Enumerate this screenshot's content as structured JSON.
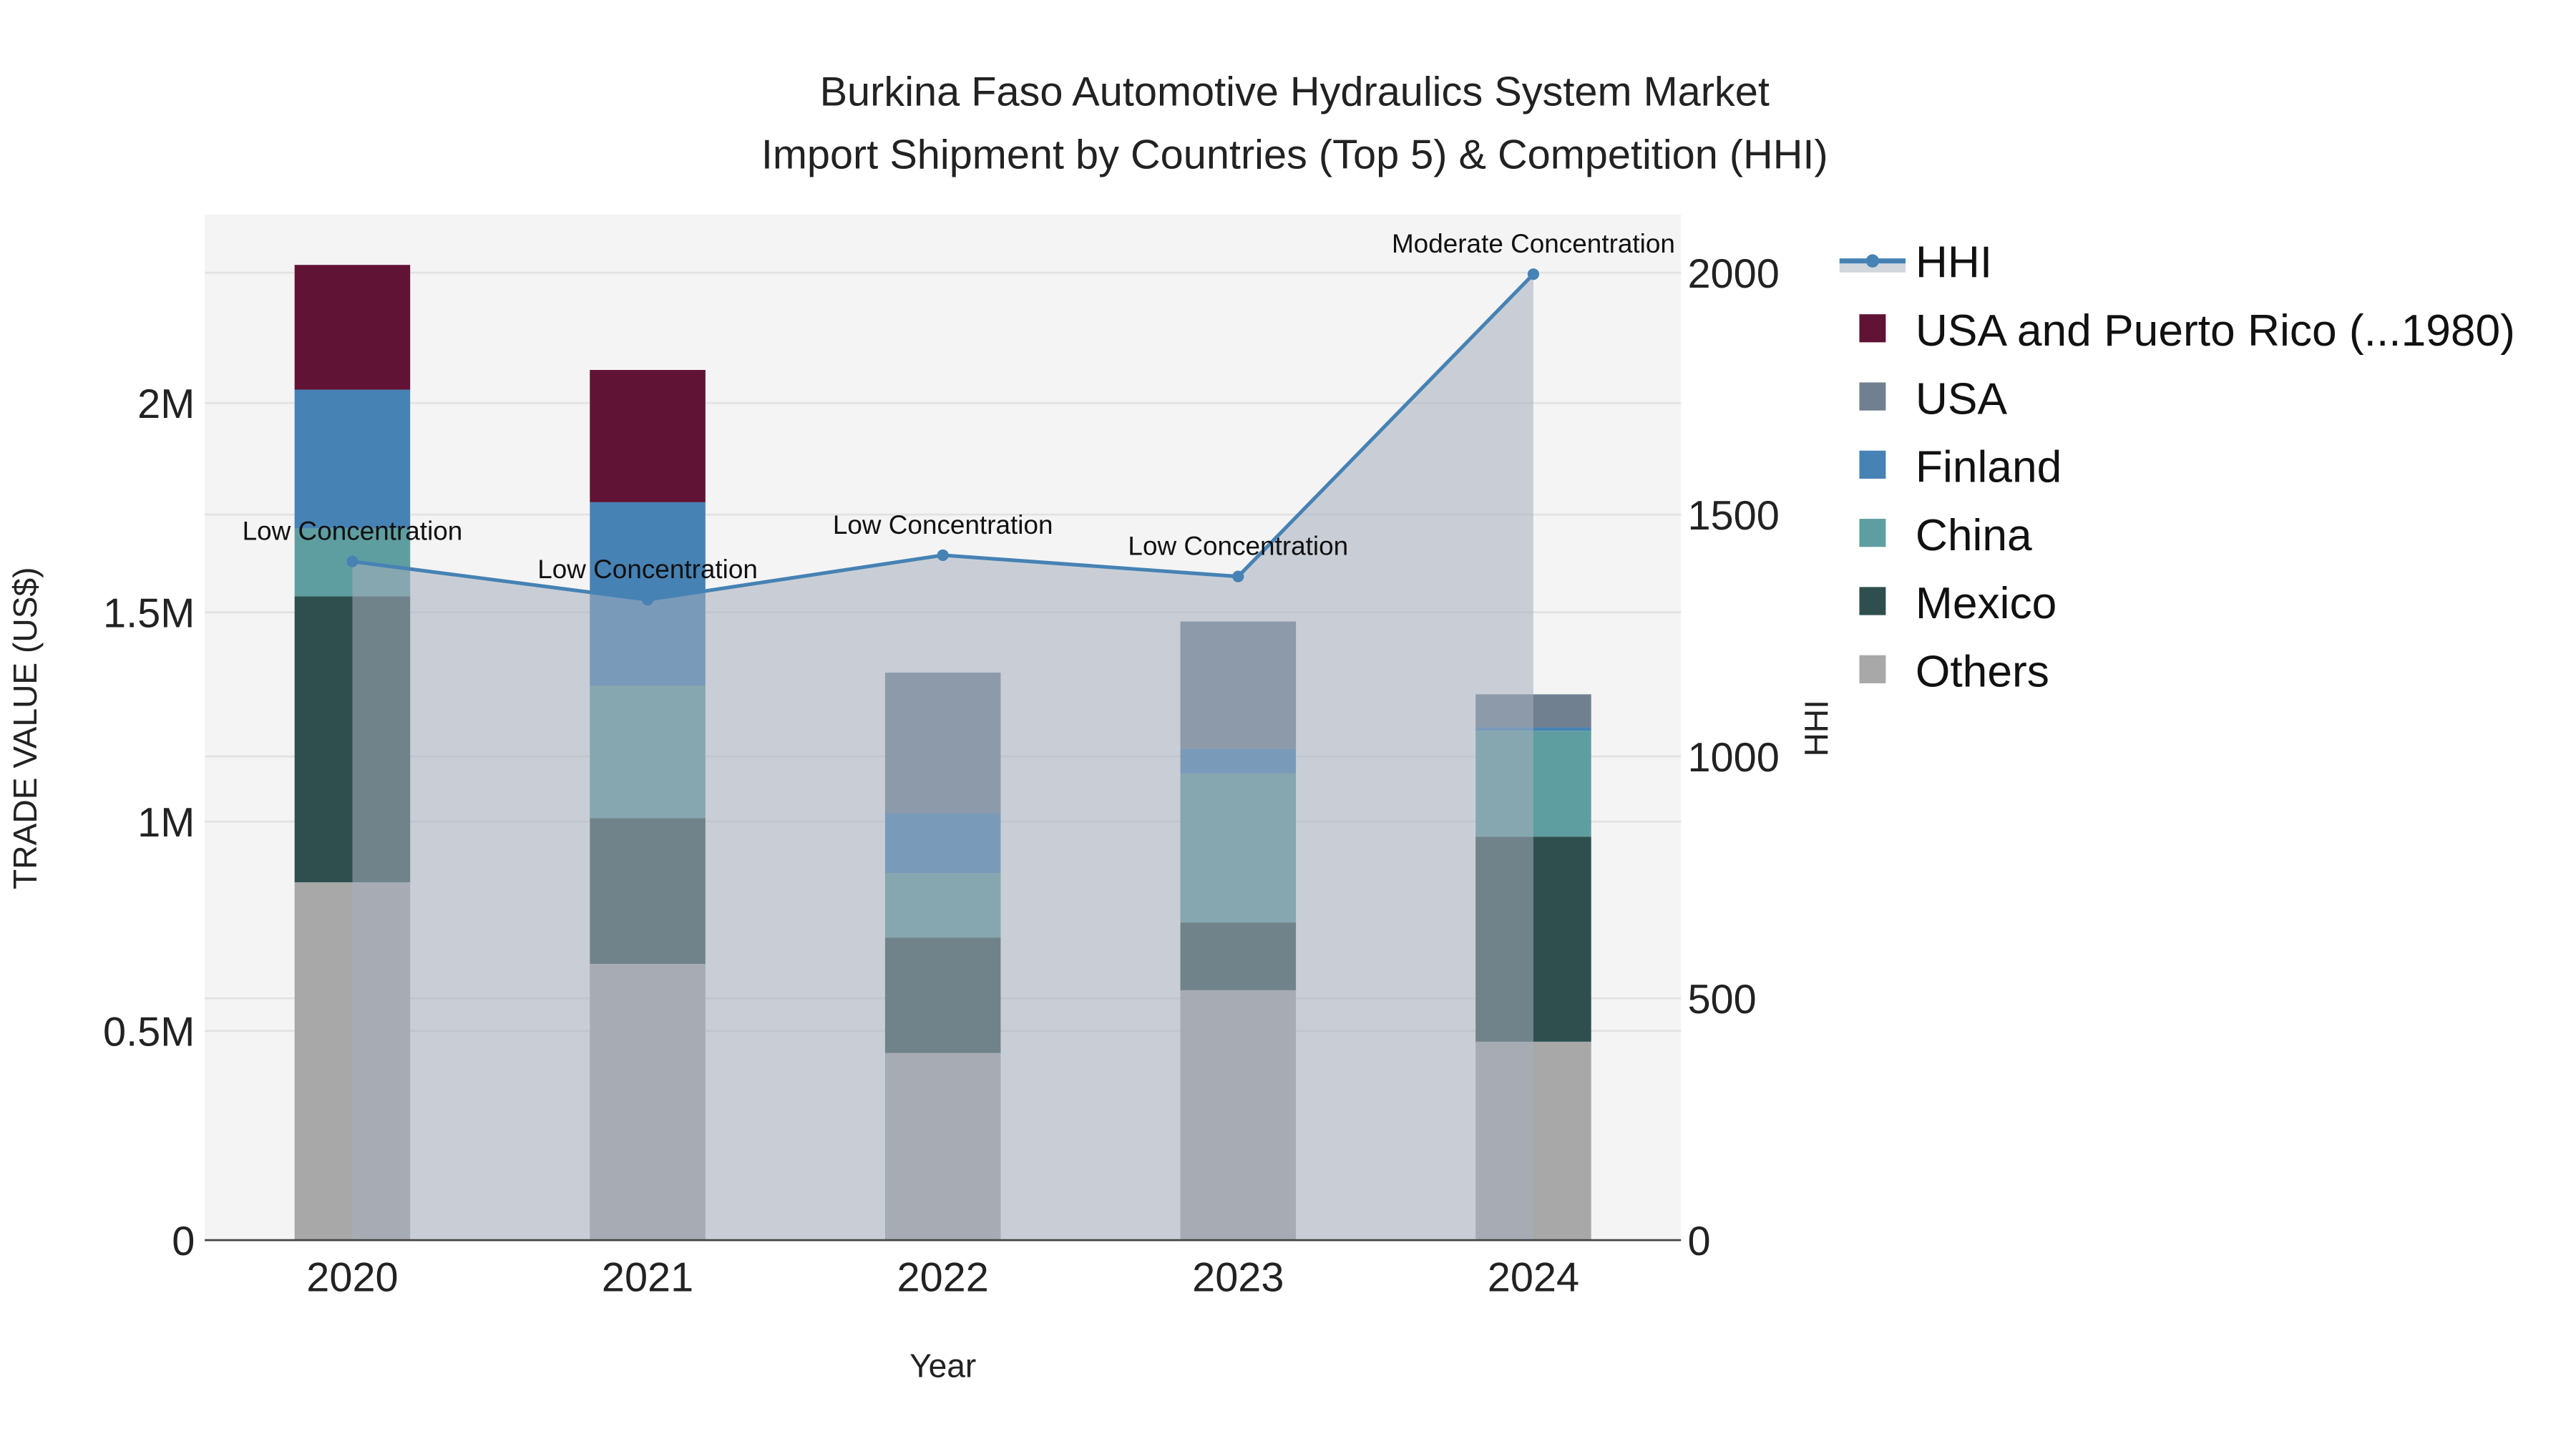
{
  "chart_data": {
    "type": "bar",
    "title_line1": "Burkina Faso Automotive Hydraulics System Market",
    "title_line2": "Import Shipment by Countries (Top 5) & Competition (HHI)",
    "xlabel": "Year",
    "ylabel": "TRADE VALUE (US$)",
    "y2label": "HHI",
    "categories": [
      "2020",
      "2021",
      "2022",
      "2023",
      "2024"
    ],
    "ylim": [
      0,
      2450000
    ],
    "y2lim": [
      0,
      2120
    ],
    "yticks": [
      {
        "v": 0,
        "label": "0"
      },
      {
        "v": 500000,
        "label": "0.5M"
      },
      {
        "v": 1000000,
        "label": "1M"
      },
      {
        "v": 1500000,
        "label": "1.5M"
      },
      {
        "v": 2000000,
        "label": "2M"
      }
    ],
    "y2ticks": [
      {
        "v": 0,
        "label": "0"
      },
      {
        "v": 500,
        "label": "500"
      },
      {
        "v": 1000,
        "label": "1000"
      },
      {
        "v": 1500,
        "label": "1500"
      },
      {
        "v": 2000,
        "label": "2000"
      }
    ],
    "series": [
      {
        "name": "Others",
        "color": "#a8a8a8",
        "values": [
          855000,
          660000,
          447000,
          597000,
          474000
        ]
      },
      {
        "name": "Mexico",
        "color": "#2f4f4f",
        "values": [
          683000,
          348000,
          276000,
          162000,
          490000
        ]
      },
      {
        "name": "China",
        "color": "#5f9ea0",
        "values": [
          162000,
          316000,
          154000,
          356000,
          253000
        ]
      },
      {
        "name": "Finland",
        "color": "#4682b4",
        "values": [
          332000,
          439000,
          143000,
          59000,
          8000
        ]
      },
      {
        "name": "USA",
        "color": "#708090",
        "values": [
          0,
          0,
          336000,
          304000,
          79000
        ]
      },
      {
        "name": "USA and Puerto Rico (...1980)",
        "color": "#611335",
        "values": [
          298000,
          316000,
          0,
          0,
          0
        ]
      }
    ],
    "hhi": {
      "name": "HHI",
      "color": "#4682b4",
      "values": [
        1403,
        1324,
        1416,
        1372,
        1997
      ],
      "labels": [
        "Low Concentration",
        "Low Concentration",
        "Low Concentration",
        "Low Concentration",
        "Moderate Concentration"
      ]
    },
    "legend_order": [
      "HHI",
      "USA and Puerto Rico (...1980)",
      "USA",
      "Finland",
      "China",
      "Mexico",
      "Others"
    ],
    "legend_placement": "right",
    "grid": true
  }
}
